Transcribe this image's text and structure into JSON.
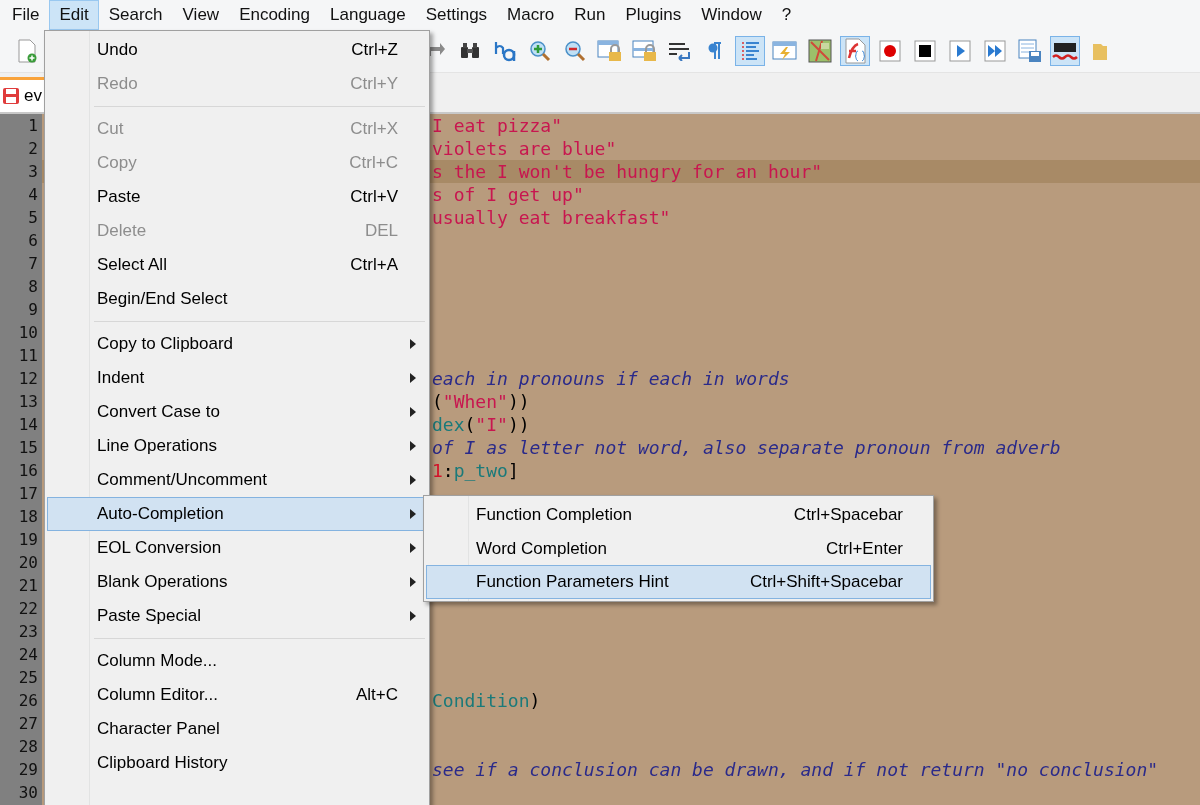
{
  "menubar": [
    {
      "label": "File",
      "selected": false
    },
    {
      "label": "Edit",
      "selected": true
    },
    {
      "label": "Search",
      "selected": false
    },
    {
      "label": "View",
      "selected": false
    },
    {
      "label": "Encoding",
      "selected": false
    },
    {
      "label": "Language",
      "selected": false
    },
    {
      "label": "Settings",
      "selected": false
    },
    {
      "label": "Macro",
      "selected": false
    },
    {
      "label": "Run",
      "selected": false
    },
    {
      "label": "Plugins",
      "selected": false
    },
    {
      "label": "Window",
      "selected": false
    },
    {
      "label": "?",
      "selected": false
    }
  ],
  "toolbar": {
    "left": [
      {
        "pressed": false
      }
    ],
    "right": [
      {
        "pressed": false
      },
      {
        "pressed": false
      },
      {
        "pressed": false
      },
      {
        "pressed": false
      },
      {
        "pressed": false
      },
      {
        "pressed": false
      },
      {
        "pressed": false
      },
      {
        "pressed": false
      },
      {
        "pressed": false
      },
      {
        "pressed": true
      },
      {
        "pressed": false
      },
      {
        "pressed": false
      },
      {
        "pressed": true
      },
      {
        "pressed": false
      },
      {
        "pressed": false
      },
      {
        "pressed": false
      },
      {
        "pressed": false
      },
      {
        "pressed": false
      },
      {
        "pressed": true
      },
      {
        "pressed": false
      }
    ]
  },
  "tab": {
    "label": "ev"
  },
  "editor": {
    "line_numbers": [
      "1",
      "2",
      "3",
      "4",
      "5",
      "6",
      "7",
      "8",
      "9",
      "10",
      "11",
      "12",
      "13",
      "14",
      "15",
      "16",
      "17",
      "18",
      "19",
      "20",
      "21",
      "22",
      "23",
      "24",
      "25",
      "26",
      "27",
      "28",
      "29",
      "30"
    ],
    "lines": [
      {
        "current": false,
        "segments": [
          {
            "kind": "string",
            "text": "I eat pizza\""
          }
        ]
      },
      {
        "current": false,
        "segments": [
          {
            "kind": "string",
            "text": "violets are blue\""
          }
        ]
      },
      {
        "current": true,
        "segments": [
          {
            "kind": "string",
            "text": "s the I won't be hungry for an hour\""
          }
        ]
      },
      {
        "current": false,
        "segments": [
          {
            "kind": "string",
            "text": "s of I get up\""
          }
        ]
      },
      {
        "current": false,
        "segments": [
          {
            "kind": "string",
            "text": "usually eat breakfast\""
          }
        ]
      },
      {
        "current": false
      },
      {
        "current": false
      },
      {
        "current": false
      },
      {
        "current": false
      },
      {
        "current": false
      },
      {
        "current": false
      },
      {
        "current": false,
        "segments": [
          {
            "kind": "comment",
            "text": "each in pronouns if each in words"
          }
        ]
      },
      {
        "current": false,
        "segments": [
          {
            "kind": "op",
            "text": "("
          },
          {
            "kind": "string",
            "text": "\"When\""
          },
          {
            "kind": "op",
            "text": "))"
          }
        ]
      },
      {
        "current": false,
        "segments": [
          {
            "kind": "ident",
            "text": "dex"
          },
          {
            "kind": "op",
            "text": "("
          },
          {
            "kind": "string",
            "text": "\"I\""
          },
          {
            "kind": "op",
            "text": "))"
          }
        ]
      },
      {
        "current": false,
        "segments": [
          {
            "kind": "comment",
            "text": "of I as letter not word, also separate pronoun from adverb"
          }
        ]
      },
      {
        "current": false,
        "segments": [
          {
            "kind": "number",
            "text": "1"
          },
          {
            "kind": "op",
            "text": ":"
          },
          {
            "kind": "ident",
            "text": "p_two"
          },
          {
            "kind": "op",
            "text": "]"
          }
        ]
      },
      {
        "current": false
      },
      {
        "current": false
      },
      {
        "current": false
      },
      {
        "current": false
      },
      {
        "current": false
      },
      {
        "current": false
      },
      {
        "current": false
      },
      {
        "current": false
      },
      {
        "current": false
      },
      {
        "current": false,
        "segments": [
          {
            "kind": "ident",
            "text": "Condition"
          },
          {
            "kind": "op",
            "text": ")"
          }
        ]
      },
      {
        "current": false
      },
      {
        "current": false
      },
      {
        "current": false,
        "segments": [
          {
            "kind": "comment",
            "text": "see if a conclusion can be drawn, and if not return \"no conclusion\""
          }
        ]
      },
      {
        "current": false
      }
    ]
  },
  "edit_menu": [
    {
      "kind": "command",
      "label": "Undo",
      "shortcut": "Ctrl+Z",
      "disabled": false,
      "selected": false
    },
    {
      "kind": "command",
      "label": "Redo",
      "shortcut": "Ctrl+Y",
      "disabled": true,
      "selected": false
    },
    {
      "kind": "separator"
    },
    {
      "kind": "command",
      "label": "Cut",
      "shortcut": "Ctrl+X",
      "disabled": true,
      "selected": false
    },
    {
      "kind": "command",
      "label": "Copy",
      "shortcut": "Ctrl+C",
      "disabled": true,
      "selected": false
    },
    {
      "kind": "command",
      "label": "Paste",
      "shortcut": "Ctrl+V",
      "disabled": false,
      "selected": false
    },
    {
      "kind": "command",
      "label": "Delete",
      "shortcut": "DEL",
      "disabled": true,
      "selected": false
    },
    {
      "kind": "command",
      "label": "Select All",
      "shortcut": "Ctrl+A",
      "disabled": false,
      "selected": false
    },
    {
      "kind": "command",
      "label": "Begin/End Select",
      "disabled": false,
      "selected": false
    },
    {
      "kind": "separator"
    },
    {
      "kind": "submenu",
      "label": "Copy to Clipboard",
      "disabled": false,
      "selected": false
    },
    {
      "kind": "submenu",
      "label": "Indent",
      "disabled": false,
      "selected": false
    },
    {
      "kind": "submenu",
      "label": "Convert Case to",
      "disabled": false,
      "selected": false
    },
    {
      "kind": "submenu",
      "label": "Line Operations",
      "disabled": false,
      "selected": false
    },
    {
      "kind": "submenu",
      "label": "Comment/Uncomment",
      "disabled": false,
      "selected": false
    },
    {
      "kind": "submenu",
      "label": "Auto-Completion",
      "disabled": false,
      "selected": true
    },
    {
      "kind": "submenu",
      "label": "EOL Conversion",
      "disabled": false,
      "selected": false
    },
    {
      "kind": "submenu",
      "label": "Blank Operations",
      "disabled": false,
      "selected": false
    },
    {
      "kind": "submenu",
      "label": "Paste Special",
      "disabled": false,
      "selected": false
    },
    {
      "kind": "separator"
    },
    {
      "kind": "command",
      "label": "Column Mode...",
      "disabled": false,
      "selected": false
    },
    {
      "kind": "command",
      "label": "Column Editor...",
      "shortcut": "Alt+C",
      "disabled": false,
      "selected": false
    },
    {
      "kind": "command",
      "label": "Character Panel",
      "disabled": false,
      "selected": false
    },
    {
      "kind": "command",
      "label": "Clipboard History",
      "disabled": false,
      "selected": false
    }
  ],
  "submenu": [
    {
      "label": "Function Completion",
      "shortcut": "Ctrl+Spacebar",
      "selected": false
    },
    {
      "label": "Word Completion",
      "shortcut": "Ctrl+Enter",
      "selected": false
    },
    {
      "label": "Function Parameters Hint",
      "shortcut": "Ctrl+Shift+Spacebar",
      "selected": true
    }
  ]
}
